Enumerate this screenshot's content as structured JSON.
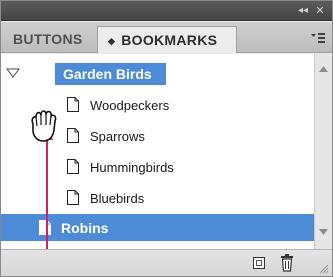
{
  "panel": {
    "tabs": [
      {
        "label": "BUTTONS",
        "active": false
      },
      {
        "label": "BOOKMARKS",
        "active": true
      }
    ],
    "header_icons": [
      "collapse-panel-icon",
      "close-icon",
      "panel-menu-icon"
    ]
  },
  "bookmarks": {
    "parent": {
      "label": "Garden Birds",
      "expanded": true,
      "highlighted": true
    },
    "children": [
      {
        "label": "Woodpeckers"
      },
      {
        "label": "Sparrows"
      },
      {
        "label": "Hummingbirds"
      },
      {
        "label": "Bluebirds"
      }
    ],
    "dragged": {
      "label": "Robins",
      "selected": true
    }
  },
  "footer_icons": [
    "new-bookmark-icon",
    "trash-icon",
    "resize-grip-icon"
  ],
  "colors": {
    "selection": "#4d8bd6",
    "drag_arrow": "#c9236f",
    "title_strip": "#4f4f4f",
    "tab_row": "#c6c6c6"
  }
}
